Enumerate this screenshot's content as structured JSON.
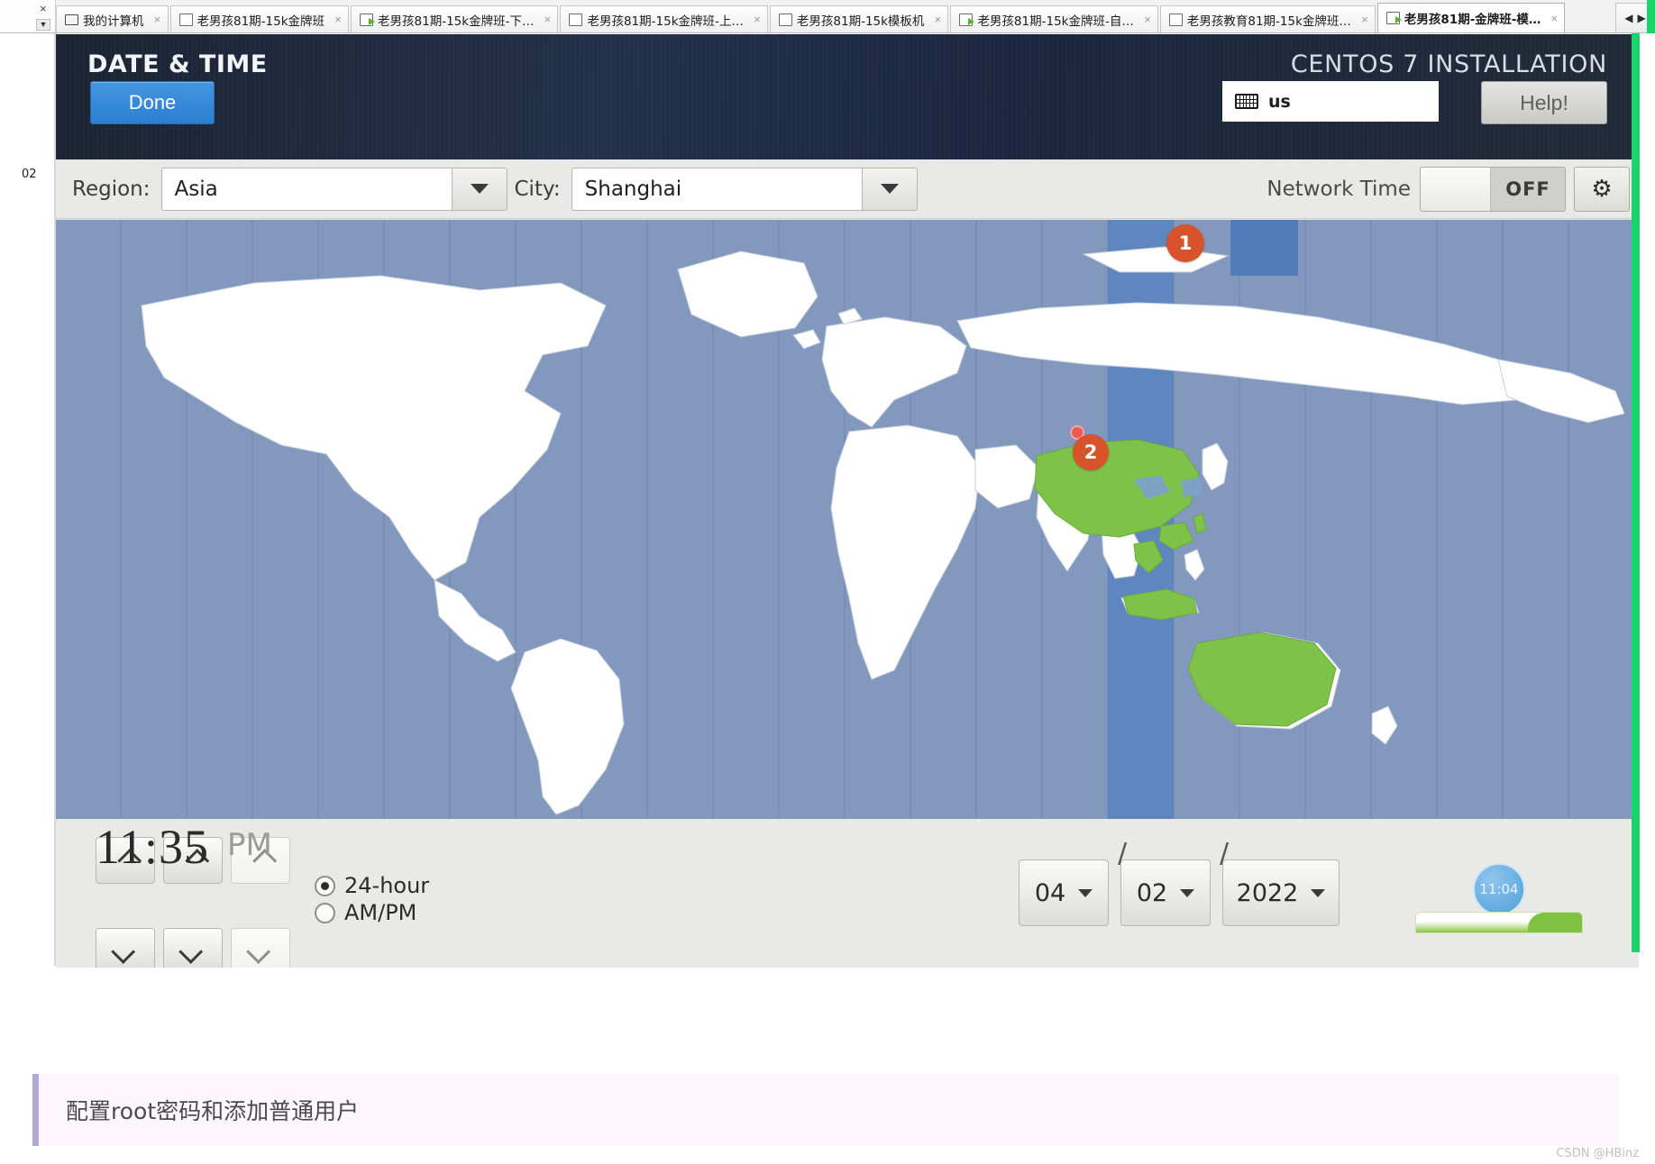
{
  "browser": {
    "tabs": [
      {
        "label": "我的计算机",
        "icon": "monitor-icon",
        "active": false
      },
      {
        "label": "老男孩81期-15k金牌班",
        "icon": "page-icon",
        "active": false
      },
      {
        "label": "老男孩81期-15k金牌班-下…",
        "icon": "play-icon",
        "active": false
      },
      {
        "label": "老男孩81期-15k金牌班-上…",
        "icon": "page-icon",
        "active": false
      },
      {
        "label": "老男孩81期-15k模板机",
        "icon": "page-icon",
        "active": false
      },
      {
        "label": "老男孩81期-15k金牌班-自…",
        "icon": "play-icon",
        "active": false
      },
      {
        "label": "老男孩教育81期-15k金牌班…",
        "icon": "page-icon",
        "active": false
      },
      {
        "label": "老男孩81期-金牌班-模…",
        "icon": "play-icon",
        "active": true
      }
    ],
    "close_glyph": "×",
    "nav_close": "×",
    "nav_down": "▼",
    "arrow_left": "◀",
    "arrow_right": "▶"
  },
  "gutter": {
    "line_number": "02"
  },
  "installer": {
    "screen_title": "DATE & TIME",
    "product_title": "CENTOS 7 INSTALLATION",
    "done_label": "Done",
    "help_label": "Help!",
    "keyboard_layout": "us",
    "keyboard_icon": "keyboard-icon"
  },
  "toolbar": {
    "region_label": "Region:",
    "region_value": "Asia",
    "city_label": "City:",
    "city_value": "Shanghai",
    "network_time_label": "Network Time",
    "network_time_state": "OFF",
    "gear_icon": "gear-icon",
    "caret_icon": "chevron-down-icon"
  },
  "map": {
    "markers": [
      {
        "id": "1",
        "label": "1"
      },
      {
        "id": "2",
        "label": "2"
      }
    ],
    "selected_city_pin": "map-pin-shanghai",
    "highlight_color": "#7ec24a",
    "ocean_color": "#8299bd",
    "land_color": "#ffffff",
    "selected_zone_color": "#5c86c0"
  },
  "clock": {
    "time": "11:35",
    "meridiem": "PM",
    "format_options": [
      {
        "label": "24-hour",
        "selected": true
      },
      {
        "label": "AM/PM",
        "selected": false
      }
    ],
    "up_icon": "chevron-up-icon",
    "down_icon": "chevron-down-icon"
  },
  "date": {
    "month": "04",
    "day": "02",
    "year": "2022",
    "separator": "/",
    "caret_icon": "chevron-down-icon"
  },
  "overlays": {
    "qq_time": "11:04"
  },
  "callout": {
    "text": "配置root密码和添加普通用户"
  },
  "watermark": "CSDN @HBinz",
  "colors": {
    "accent_blue": "#2a7fd0",
    "marker_orange": "#d8532c",
    "header_navy": "#22304a",
    "green_bar": "#19d46a",
    "callout_border": "#b4a8d8"
  }
}
